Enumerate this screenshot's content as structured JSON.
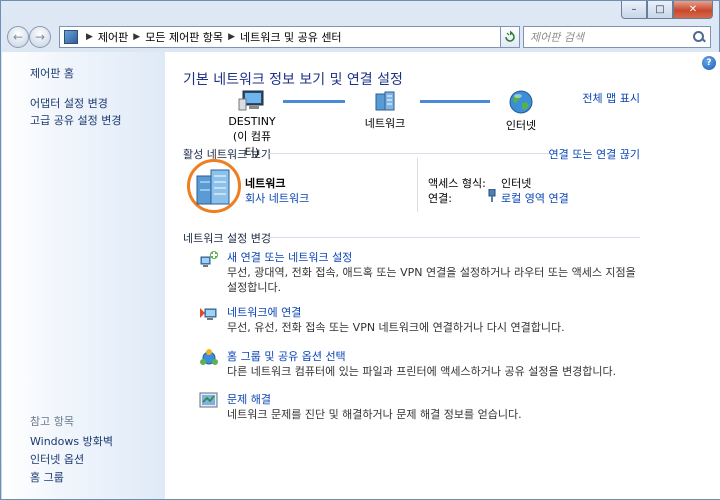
{
  "window": {
    "caption_buttons": {
      "minimize": "–",
      "maximize": "□",
      "close": "✕"
    }
  },
  "nav": {
    "back_glyph": "←",
    "forward_glyph": "→",
    "breadcrumbs": [
      "제어판",
      "모든 제어판 항목",
      "네트워크 및 공유 센터"
    ],
    "search_placeholder": "제어판 검색",
    "icons": {
      "address": "control-panel-icon",
      "refresh": "refresh-icon",
      "search": "search-icon"
    }
  },
  "sidebar": {
    "home": "제어판 홈",
    "links": [
      "어댑터 설정 변경",
      "고급 공유 설정 변경"
    ],
    "see_also_title": "참고 항목",
    "see_also": [
      "Windows 방화벽",
      "인터넷 옵션",
      "홈 그룹"
    ]
  },
  "main": {
    "help_glyph": "?",
    "title": "기본 네트워크 정보 보기 및 연결 설정",
    "full_map_link": "전체 맵 표시",
    "map": {
      "computer_name": "DESTINY",
      "computer_sub": "(이 컴퓨터)",
      "network_label": "네트워크",
      "internet_label": "인터넷"
    },
    "active_section_title": "활성 네트워크 보기",
    "connect_disconnect_link": "연결 또는 연결 끊기",
    "active_network": {
      "name": "네트워크",
      "type": "회사 네트워크",
      "access_type_label": "액세스 형식:",
      "access_type_value": "인터넷",
      "connections_label": "연결:",
      "connections_value": "로컬 영역 연결"
    },
    "change_section_title": "네트워크 설정 변경",
    "tasks": [
      {
        "title": "새 연결 또는 네트워크 설정",
        "desc": "무선, 광대역, 전화 접속, 애드혹 또는 VPN 연결을 설정하거나 라우터 또는 액세스 지점을 설정합니다.",
        "icon": "new-connection-icon"
      },
      {
        "title": "네트워크에 연결",
        "desc": "무선, 유선, 전화 접속 또는 VPN 네트워크에 연결하거나 다시 연결합니다.",
        "icon": "connect-network-icon"
      },
      {
        "title": "홈 그룹 및 공유 옵션 선택",
        "desc": "다른 네트워크 컴퓨터에 있는 파일과 프린터에 액세스하거나 공유 설정을 변경합니다.",
        "icon": "homegroup-icon"
      },
      {
        "title": "문제 해결",
        "desc": "네트워크 문제를 진단 및 해결하거나 문제 해결 정보를 얻습니다.",
        "icon": "troubleshoot-icon"
      }
    ]
  },
  "colors": {
    "link": "#0a46b5",
    "title": "#1e3287",
    "highlight": "#f07d1e",
    "sidebar_link": "#1b3a70"
  }
}
